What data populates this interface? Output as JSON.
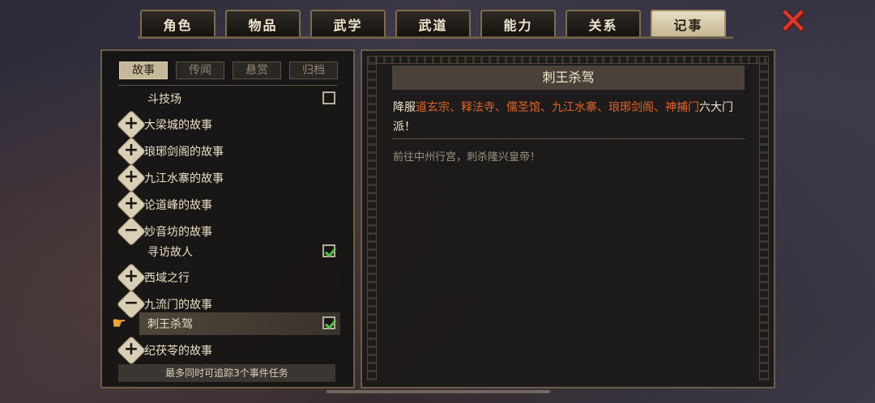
{
  "tabs": [
    "角色",
    "物品",
    "武学",
    "武道",
    "能力",
    "关系",
    "记事"
  ],
  "active_tab": "记事",
  "subtabs": [
    "故事",
    "传闻",
    "悬赏",
    "归档"
  ],
  "active_subtab": "故事",
  "list": [
    {
      "kind": "sub",
      "label": "斗技场",
      "checked": false
    },
    {
      "kind": "group",
      "label": "大梁城的故事",
      "expanded": false
    },
    {
      "kind": "group",
      "label": "琅琊剑阁的故事",
      "expanded": false
    },
    {
      "kind": "group",
      "label": "九江水寨的故事",
      "expanded": false
    },
    {
      "kind": "group",
      "label": "论道峰的故事",
      "expanded": false
    },
    {
      "kind": "group",
      "label": "妙音坊的故事",
      "expanded": true
    },
    {
      "kind": "sub",
      "label": "寻访故人",
      "checked": true
    },
    {
      "kind": "group",
      "label": "西域之行",
      "expanded": false
    },
    {
      "kind": "group",
      "label": "九流门的故事",
      "expanded": true
    },
    {
      "kind": "sub",
      "label": "刺王杀驾",
      "checked": true,
      "selected": true
    },
    {
      "kind": "group",
      "label": "纪茯苓的故事",
      "expanded": false
    }
  ],
  "footer_note": "最多同时可追踪3个事件任务",
  "detail": {
    "title": "刺王杀驾",
    "desc_prefix": "降服",
    "factions": [
      "道玄宗",
      "释法寺",
      "儒圣馆",
      "九江水寨",
      "琅琊剑阁",
      "神捕门"
    ],
    "desc_suffix": "六大门派！",
    "task": "前往中州行宫，刺杀隆兴皇帝！"
  },
  "colors": {
    "highlight": "#e0642a",
    "check": "#58c14a",
    "close": "#d63a2a"
  }
}
